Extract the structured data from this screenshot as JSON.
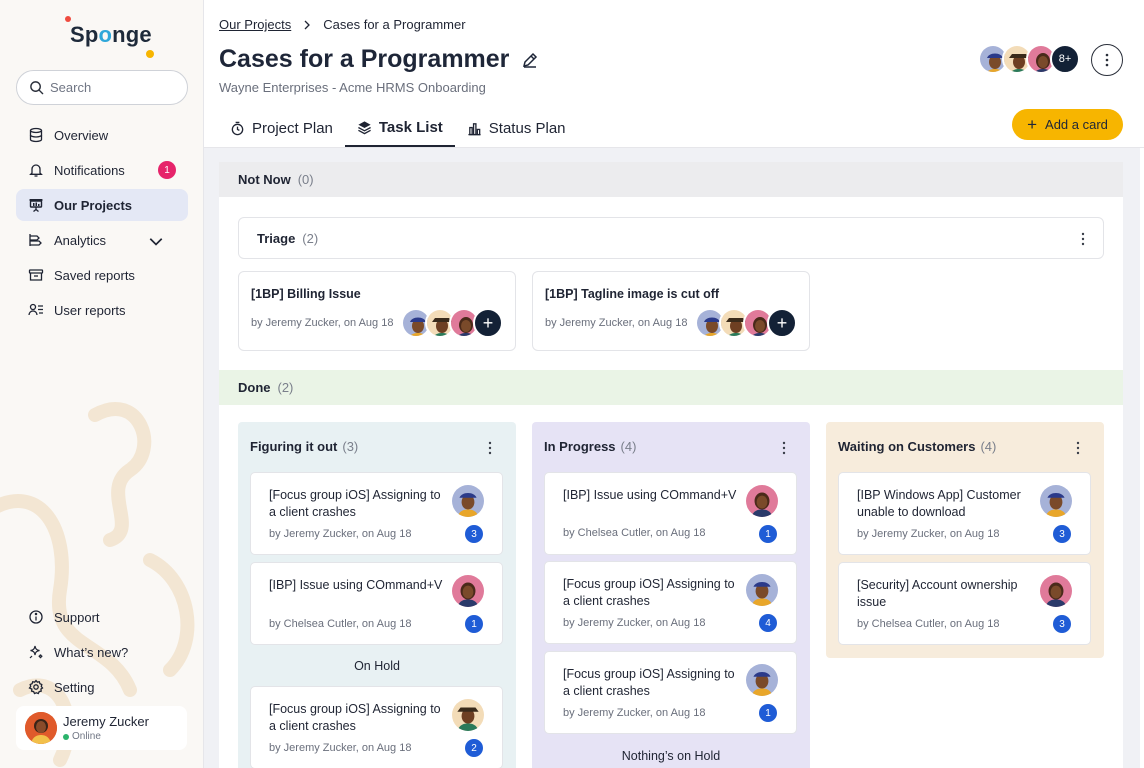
{
  "app": {
    "logo_text": "Sp",
    "logo_o": "o",
    "logo_rest": "nge"
  },
  "sidebar": {
    "search_placeholder": "Search",
    "items": [
      {
        "label": "Overview",
        "icon": "database-icon"
      },
      {
        "label": "Notifications",
        "icon": "bell-icon",
        "badge": "1"
      },
      {
        "label": "Our Projects",
        "icon": "presentation-icon",
        "active": true
      },
      {
        "label": "Analytics",
        "icon": "analytics-icon"
      },
      {
        "label": "Saved reports",
        "icon": "archive-icon"
      },
      {
        "label": "User reports",
        "icon": "user-list-icon"
      }
    ],
    "bottom_items": [
      {
        "label": "Support",
        "icon": "info-icon"
      },
      {
        "label": "What’s new?",
        "icon": "sparkle-icon"
      },
      {
        "label": "Setting",
        "icon": "gear-icon"
      }
    ],
    "user": {
      "name": "Jeremy Zucker",
      "status": "Online"
    }
  },
  "header": {
    "breadcrumb": {
      "parent": "Our Projects",
      "current": "Cases for a Programmer"
    },
    "title": "Cases for a Programmer",
    "subtitle": "Wayne Enterprises - Acme HRMS Onboarding",
    "member_overflow": "8+",
    "add_card_label": "Add a card"
  },
  "tabs": [
    {
      "label": "Project Plan",
      "icon": "timer-icon"
    },
    {
      "label": "Task List",
      "icon": "layers-icon",
      "active": true
    },
    {
      "label": "Status Plan",
      "icon": "bar-chart-icon"
    }
  ],
  "groups": {
    "not_now": {
      "label": "Not Now",
      "count": "(0)"
    },
    "triage": {
      "label": "Triage",
      "count": "(2)",
      "cards": [
        {
          "title": "[1BP] Billing Issue",
          "meta": "by Jeremy Zucker, on Aug 18"
        },
        {
          "title": "[1BP] Tagline image is cut off",
          "meta": "by Jeremy Zucker, on Aug 18"
        }
      ]
    },
    "done": {
      "label": "Done",
      "count": "(2)"
    }
  },
  "columns": [
    {
      "label": "Figuring it out",
      "count": "(3)",
      "bg": "#e8f1f3",
      "cards": [
        {
          "title": "[Focus group iOS] Assigning to a client crashes",
          "meta": "by Jeremy Zucker, on Aug 18",
          "num": "3"
        },
        {
          "title": "[IBP] Issue using COmmand+V",
          "meta": "by Chelsea Cutler, on Aug 18",
          "num": "1"
        }
      ],
      "sub_label": "On Hold",
      "sub_cards": [
        {
          "title": "[Focus group iOS] Assigning to a client crashes",
          "meta": "by Jeremy Zucker, on Aug 18",
          "num": "2"
        }
      ]
    },
    {
      "label": "In Progress",
      "count": "(4)",
      "bg": "#e6e3f5",
      "cards": [
        {
          "title": "[IBP] Issue using COmmand+V",
          "meta": "by Chelsea Cutler, on Aug 18",
          "num": "1"
        },
        {
          "title": "[Focus group iOS] Assigning to a client crashes",
          "meta": "by Jeremy Zucker, on Aug 18",
          "num": "4"
        },
        {
          "title": "[Focus group iOS] Assigning to a client crashes",
          "meta": "by Jeremy Zucker, on Aug 18",
          "num": "1"
        }
      ],
      "sub_label": "Nothing’s on Hold"
    },
    {
      "label": "Waiting on Customers",
      "count": "(4)",
      "bg": "#f7ecdc",
      "cards": [
        {
          "title": "[IBP Windows App] Customer unable to download",
          "meta": "by Jeremy Zucker, on Aug 18",
          "num": "3"
        },
        {
          "title": "[Security] Account ownership issue",
          "meta": "by Chelsea Cutler, on Aug 18",
          "num": "3"
        }
      ]
    }
  ],
  "colors": {
    "accent": "#f7b500",
    "dark": "#132136",
    "badge": "#e6246a",
    "count_chip": "#1f5cd6",
    "active_nav": "#e4e8f5"
  }
}
